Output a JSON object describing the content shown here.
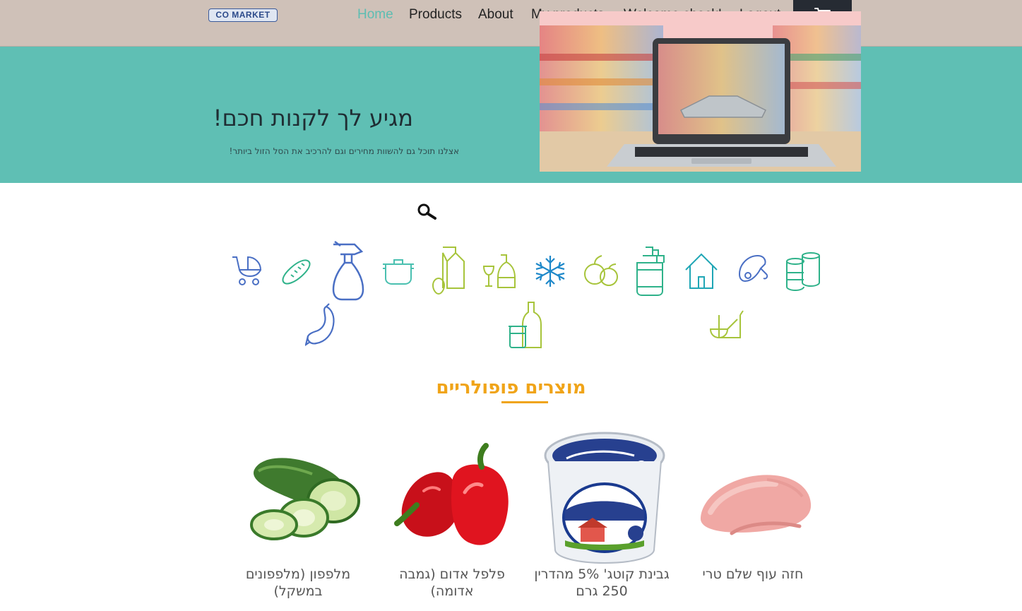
{
  "navbar": {
    "logo_text": "CO MARKET",
    "items": [
      {
        "label": "Home",
        "active": true
      },
      {
        "label": "Products"
      },
      {
        "label": "About"
      },
      {
        "label": "My products"
      },
      {
        "label": "Welcome check!"
      },
      {
        "label": "Logout"
      }
    ],
    "cart_icon": "shopping-cart-icon",
    "background": "#cfc1b8",
    "active_color": "#5dbdb2"
  },
  "hero": {
    "title": "מגיע לך לקנות חכם!",
    "subtitle": "אצלנו תוכל גם להשוות מחירים וגם להרכיב את הסל הזול ביותר!",
    "image": "laptop-supermarket-image",
    "background": "#5fbfb4"
  },
  "search": {
    "icon": "search-icon"
  },
  "categories": [
    {
      "icon": "baby-stroller-icon"
    },
    {
      "icon": "bread-icon"
    },
    {
      "icon": "spray-bottle-icon"
    },
    {
      "icon": "cooking-pot-icon"
    },
    {
      "icon": "milk-carton-icon"
    },
    {
      "icon": "wine-icon"
    },
    {
      "icon": "snowflake-icon"
    },
    {
      "icon": "fruit-icon"
    },
    {
      "icon": "soap-dispenser-icon"
    },
    {
      "icon": "house-icon"
    },
    {
      "icon": "chicken-leg-icon"
    },
    {
      "icon": "canned-food-icon"
    },
    {
      "icon": "sausage-icon"
    },
    {
      "icon": "bottles-jar-icon"
    },
    {
      "icon": "kitchenware-icon"
    }
  ],
  "popular": {
    "title": "מוצרים פופולריים",
    "accent": "#f0a418",
    "products": [
      {
        "name": "מלפפון (מלפפונים במשקל)",
        "image": "cucumber-image"
      },
      {
        "name": "פלפל אדום (גמבה אדומה)",
        "image": "red-pepper-image"
      },
      {
        "name": "גבינת קוטג' 5% מהדרין 250 גרם",
        "image": "cottage-cheese-image"
      },
      {
        "name": "חזה עוף שלם טרי",
        "image": "chicken-breast-image"
      }
    ]
  }
}
